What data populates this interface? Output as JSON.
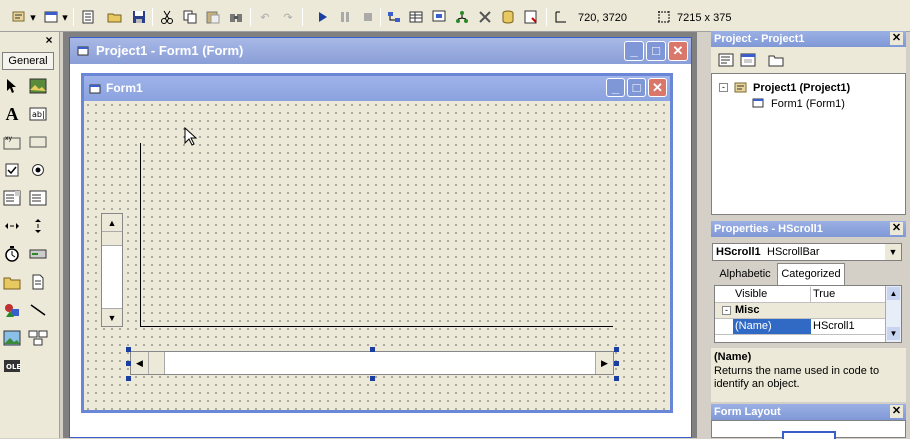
{
  "toolbar": {
    "position_readout": "720, 3720",
    "size_readout": "7215 x 375"
  },
  "toolbox": {
    "tab_label": "General",
    "close_label": "×"
  },
  "outer_window": {
    "title": "Project1 - Form1 (Form)"
  },
  "form1": {
    "title": "Form1"
  },
  "project_panel": {
    "title": "Project - Project1",
    "root_node": "Project1 (Project1)",
    "child_node": "Form1 (Form1)"
  },
  "properties_panel": {
    "title": "Properties - HScroll1",
    "object_name": "HScroll1",
    "object_type": "HScrollBar",
    "tabs": [
      "Alphabetic",
      "Categorized"
    ],
    "rows": [
      {
        "name": "Visible",
        "value": "True"
      },
      {
        "name": "Misc",
        "value": ""
      },
      {
        "name": "(Name)",
        "value": "HScroll1"
      }
    ],
    "desc_title": "(Name)",
    "desc_text": "Returns the name used in code to identify an object."
  },
  "form_layout_panel": {
    "title": "Form Layout"
  },
  "colors": {
    "accent_blue": "#3a5fcd",
    "selection": "#316ac5"
  }
}
